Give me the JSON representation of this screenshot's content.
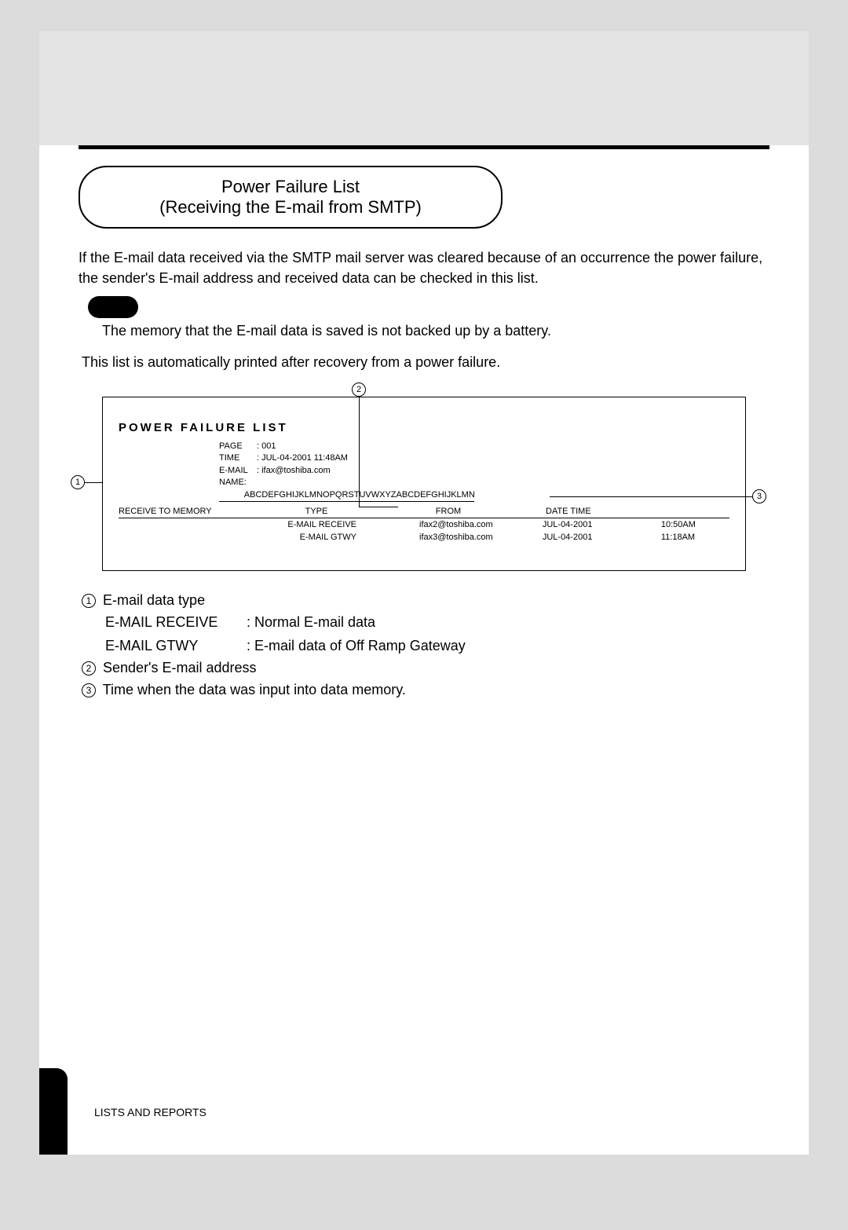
{
  "title": {
    "line1": "Power Failure List",
    "line2": "(Receiving the E-mail from SMTP)"
  },
  "intro": "If the E-mail data received via the SMTP mail server was cleared because of an occurrence the power failure, the sender's E-mail address and received data can be checked in this list.",
  "note": "The memory that the E-mail data is saved is not backed up by a battery.",
  "auto": "This list is automatically printed after recovery from a power failure.",
  "callouts": {
    "c1": "1",
    "c2": "2",
    "c3": "3"
  },
  "sample": {
    "title": "POWER FAILURE LIST",
    "meta": {
      "page_label": "PAGE",
      "page_value": ": 001",
      "time_label": "TIME",
      "time_value": ": JUL-04-2001   11:48AM",
      "email_label": "E-MAIL",
      "email_value": ": ifax@toshiba.com",
      "name_label": "NAME",
      "name_value": ": ABCDEFGHIJKLMNOPQRSTUVWXYZABCDEFGHIJKLMN"
    },
    "headers": {
      "rtm": "RECEIVE TO MEMORY",
      "type": "TYPE",
      "from": "FROM",
      "dt": "DATE TIME"
    },
    "rows": [
      {
        "type": "E-MAIL RECEIVE",
        "from": "ifax2@toshiba.com",
        "date": "JUL-04-2001",
        "time": "10:50AM"
      },
      {
        "type": "E-MAIL GTWY",
        "from": "ifax3@toshiba.com",
        "date": "JUL-04-2001",
        "time": "11:18AM"
      }
    ]
  },
  "legend": {
    "n1": "1",
    "l1": "E-mail data type",
    "d1a_k": "E-MAIL RECEIVE",
    "d1a_v": ": Normal E-mail data",
    "d1b_k": "E-MAIL GTWY",
    "d1b_v": ": E-mail data of Off Ramp Gateway",
    "n2": "2",
    "l2": "Sender's E-mail address",
    "n3": "3",
    "l3": "Time when the data was input into data memory."
  },
  "footer": "LISTS AND REPORTS"
}
